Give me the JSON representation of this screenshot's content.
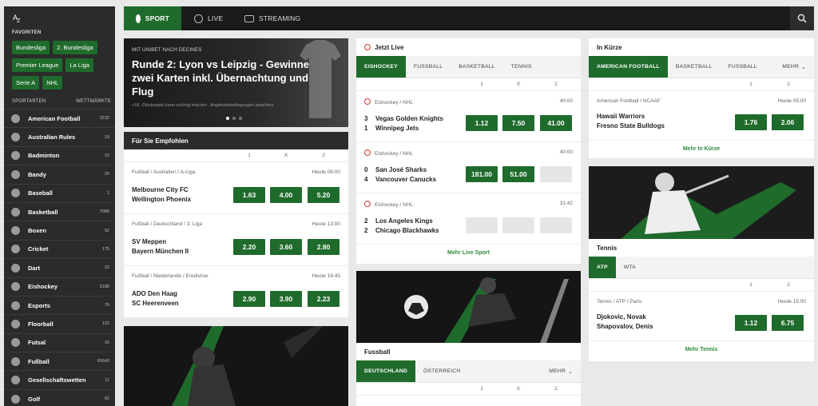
{
  "sidebar": {
    "az_a": "A",
    "az_z": "Z",
    "favorites_title": "FAVORITEN",
    "favorites": [
      "Bundesliga",
      "2. Bundesliga",
      "Premier League",
      "La Liga",
      "Serie A",
      "NHL"
    ],
    "sports_title": "SPORTARTEN",
    "markets_title": "WETTMÄRKTE",
    "sports": [
      {
        "name": "American Football",
        "count": "2232",
        "icon": "american-football-icon"
      },
      {
        "name": "Australian Rules",
        "count": "19",
        "icon": "australian-rules-icon"
      },
      {
        "name": "Badminton",
        "count": "10",
        "icon": "badminton-icon"
      },
      {
        "name": "Bandy",
        "count": "20",
        "icon": "bandy-icon"
      },
      {
        "name": "Baseball",
        "count": "2",
        "icon": "baseball-icon"
      },
      {
        "name": "Basketball",
        "count": "7085",
        "icon": "basketball-icon"
      },
      {
        "name": "Boxen",
        "count": "52",
        "icon": "boxing-icon"
      },
      {
        "name": "Cricket",
        "count": "175",
        "icon": "cricket-icon"
      },
      {
        "name": "Dart",
        "count": "22",
        "icon": "dart-icon"
      },
      {
        "name": "Eishockey",
        "count": "5188",
        "icon": "ice-hockey-icon"
      },
      {
        "name": "Esports",
        "count": "76",
        "icon": "esports-icon"
      },
      {
        "name": "Floorball",
        "count": "122",
        "icon": "floorball-icon"
      },
      {
        "name": "Futsal",
        "count": "16",
        "icon": "futsal-icon"
      },
      {
        "name": "Fußball",
        "count": "60640",
        "icon": "football-icon"
      },
      {
        "name": "Gesellschaftswetten",
        "count": "11",
        "icon": "star-icon"
      },
      {
        "name": "Golf",
        "count": "62",
        "icon": "golf-icon"
      }
    ]
  },
  "nav": {
    "sport": "SPORT",
    "live": "LIVE",
    "streaming": "STREAMING"
  },
  "banner": {
    "tag": "MIT UNIBET NACH DECINES",
    "headline": "Runde 2: Lyon vs Leipzig - Gewinne zwei Karten inkl. Übernachtung und Flug",
    "small": "+18. Glücksspiel kann süchtig machen . Angebotsbedingungen beachten"
  },
  "recommended": {
    "title": "Für Sie Empfohlen",
    "headers": [
      "1",
      "X",
      "2"
    ],
    "events": [
      {
        "league": "Fußball / Australien / A-Liga",
        "time": "Heute 06:00",
        "home": "Melbourne City FC",
        "away": "Wellington Phoenix",
        "odds": [
          "1.63",
          "4.00",
          "5.20"
        ]
      },
      {
        "league": "Fußball / Deutschland / 3. Liga",
        "time": "Heute 13:00",
        "home": "SV Meppen",
        "away": "Bayern München II",
        "odds": [
          "2.20",
          "3.60",
          "2.80"
        ]
      },
      {
        "league": "Fußball / Niederlande / Eredivisie",
        "time": "Heute 16:45",
        "home": "ADO Den Haag",
        "away": "SC Heerenveen",
        "odds": [
          "2.90",
          "3.90",
          "2.23"
        ]
      }
    ]
  },
  "live": {
    "title": "Jetzt Live",
    "tabs": [
      "EISHOCKEY",
      "FUSSBALL",
      "BASKETBALL",
      "TENNIS"
    ],
    "headers": [
      "1",
      "X",
      "2"
    ],
    "events": [
      {
        "league": "Eishockey / NHL",
        "time": "40:00",
        "home_score": "3",
        "home": "Vegas Golden Knights",
        "away_score": "1",
        "away": "Winnipeg Jets",
        "odds": [
          "1.12",
          "7.50",
          "41.00"
        ]
      },
      {
        "league": "Eishockey / NHL",
        "time": "40:00",
        "home_score": "0",
        "home": "San José Sharks",
        "away_score": "4",
        "away": "Vancouver Canucks",
        "odds": [
          "181.00",
          "51.00",
          ""
        ]
      },
      {
        "league": "Eishockey / NHL",
        "time": "31:42",
        "home_score": "2",
        "home": "Los Angeles Kings",
        "away_score": "2",
        "away": "Chicago Blackhawks",
        "odds": [
          "",
          "",
          ""
        ]
      }
    ],
    "more": "Mehr Live Sport"
  },
  "football": {
    "title": "Fussball",
    "tabs": [
      "DEUTSCHLAND",
      "ÖSTERREICH"
    ],
    "more_tab": "MEHR",
    "headers": [
      "1",
      "X",
      "2"
    ]
  },
  "soon": {
    "title": "In Kürze",
    "tabs": [
      "AMERICAN FOOTBALL",
      "BASKETBALL",
      "FUSSBALL"
    ],
    "more_tab": "MEHR",
    "headers": [
      "1",
      "2"
    ],
    "event": {
      "league": "American Football / NCAAF",
      "time": "Heute 05:00",
      "home": "Hawaii Warriors",
      "away": "Fresno State Bulldogs",
      "odds": [
        "1.76",
        "2.06"
      ]
    },
    "more": "Mehr In Kürze"
  },
  "tennis": {
    "title": "Tennis",
    "tabs": [
      "ATP",
      "WTA"
    ],
    "headers": [
      "1",
      "2"
    ],
    "event": {
      "league": "Tennis / ATP / Paris",
      "time": "Heute 15:00",
      "home": "Djokovic, Novak",
      "away": "Shapovalov, Denis",
      "odds": [
        "1.12",
        "6.75"
      ]
    },
    "more": "Mehr Tennis"
  },
  "colors": {
    "accent": "#1f6b2c",
    "link": "#2e8b3a",
    "live": "#d23b2f",
    "dark": "#2b2b2b"
  }
}
